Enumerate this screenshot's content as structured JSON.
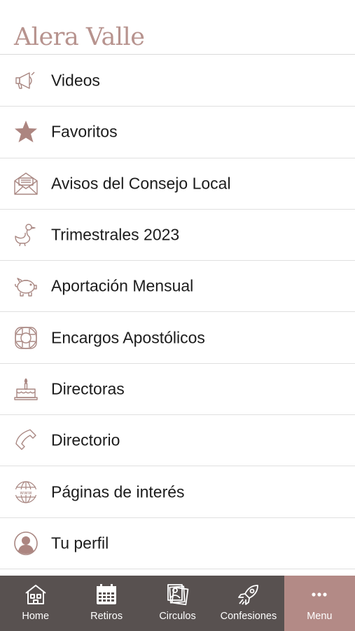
{
  "header": {
    "title": "Alera Valle"
  },
  "menu": {
    "items": [
      {
        "label": "Videos",
        "icon": "megaphone-icon"
      },
      {
        "label": "Favoritos",
        "icon": "star-icon"
      },
      {
        "label": "Avisos del Consejo Local",
        "icon": "envelope-icon"
      },
      {
        "label": "Trimestrales 2023",
        "icon": "duck-icon"
      },
      {
        "label": "Aportación Mensual",
        "icon": "piggy-bank-icon"
      },
      {
        "label": "Encargos Apostólicos",
        "icon": "lifebuoy-icon"
      },
      {
        "label": "Directoras",
        "icon": "cake-icon"
      },
      {
        "label": "Directorio",
        "icon": "phone-icon"
      },
      {
        "label": "Páginas de interés",
        "icon": "globe-icon"
      },
      {
        "label": "Tu perfil",
        "icon": "user-icon"
      }
    ]
  },
  "tabbar": {
    "tabs": [
      {
        "label": "Home",
        "icon": "house-icon",
        "active": false
      },
      {
        "label": "Retiros",
        "icon": "calendar-icon",
        "active": false
      },
      {
        "label": "Circulos",
        "icon": "photos-icon",
        "active": false
      },
      {
        "label": "Confesiones",
        "icon": "rocket-icon",
        "active": false
      },
      {
        "label": "Menu",
        "icon": "more-icon",
        "active": true
      }
    ]
  },
  "colors": {
    "accent": "#b7938e",
    "tabbar_bg": "#585150",
    "tab_active_bg": "#b38a86"
  }
}
